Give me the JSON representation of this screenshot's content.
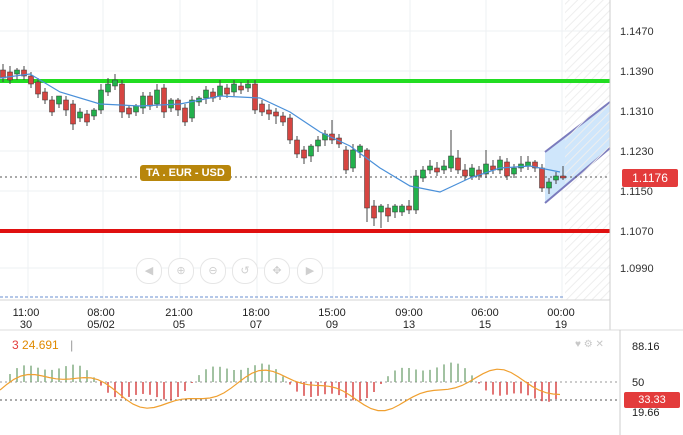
{
  "price_axis": {
    "labels": [
      "1.1470",
      "1.1390",
      "1.1310",
      "1.1230",
      "1.1150",
      "1.1070",
      "1.0990"
    ],
    "current_price": "1.1176"
  },
  "time_axis": {
    "labels": [
      {
        "top": "11:00",
        "bottom": "30"
      },
      {
        "top": "08:00",
        "bottom": "05/02"
      },
      {
        "top": "21:00",
        "bottom": "05"
      },
      {
        "top": "18:00",
        "bottom": "07"
      },
      {
        "top": "15:00",
        "bottom": "09"
      },
      {
        "top": "09:00",
        "bottom": "13"
      },
      {
        "top": "06:00",
        "bottom": "15"
      },
      {
        "top": "00:00",
        "bottom": "19"
      }
    ]
  },
  "annotation": {
    "label": "TA . EUR - USD"
  },
  "oscillator": {
    "value_label": "24.691",
    "axis_labels": [
      "88.16",
      "50",
      "19.66"
    ],
    "current_value": "33.33"
  },
  "colors": {
    "bull_candle": "#22b14c",
    "bear_candle": "#d64541",
    "resistance_line": "#22dd22",
    "support_line": "#e01010",
    "moving_average": "#4a90d9",
    "channel_fill": "#cfe6fb",
    "channel_border": "#7b7bbd",
    "osc_line": "#f0a030"
  },
  "nav_buttons": [
    {
      "icon": "scroll-left-icon",
      "glyph": "◀"
    },
    {
      "icon": "zoom-in-icon",
      "glyph": "⊕"
    },
    {
      "icon": "zoom-out-icon",
      "glyph": "⊖"
    },
    {
      "icon": "zoom-reset-icon",
      "glyph": "↺"
    },
    {
      "icon": "pan-icon",
      "glyph": "✥"
    },
    {
      "icon": "scroll-right-icon",
      "glyph": "▶"
    }
  ],
  "osc_toolbar_icons": [
    "heart-icon",
    "settings-icon",
    "close-icon"
  ]
}
